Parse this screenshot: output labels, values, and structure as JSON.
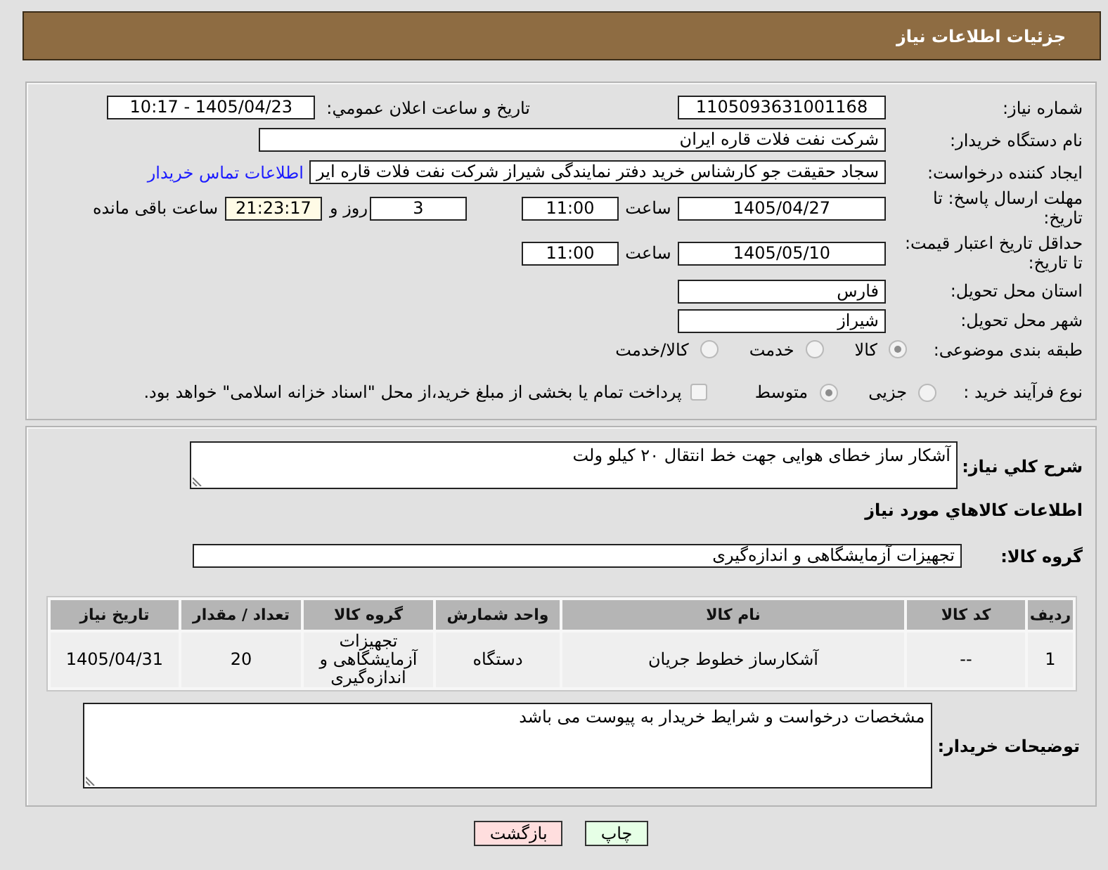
{
  "header": {
    "title": "جزئیات اطلاعات نیاز"
  },
  "details": {
    "need_number": {
      "label": "شماره نیاز:",
      "value": "1105093631001168"
    },
    "announce": {
      "label": "تاریخ و ساعت اعلان عمومي:",
      "value": "1405/04/23 - 10:17"
    },
    "buyer_org": {
      "label": "نام دستگاه خریدار:",
      "value": "شرکت نفت فلات قاره ایران"
    },
    "requester": {
      "label": "ایجاد کننده درخواست:",
      "value": "سجاد حقیقت جو کارشناس خرید دفتر نمایندگی شیراز شرکت نفت فلات قاره ایر",
      "link": "اطلاعات تماس خریدار"
    },
    "reply_deadline": {
      "label": "مهلت ارسال پاسخ: تا تاریخ:",
      "date": "1405/04/27",
      "time_label": "ساعت",
      "time": "11:00",
      "days": "3",
      "days_label": "روز و",
      "remaining": "21:23:17",
      "remaining_label": "ساعت باقی مانده"
    },
    "price_validity": {
      "label": "حداقل تاریخ اعتبار قیمت: تا تاریخ:",
      "date": "1405/05/10",
      "time_label": "ساعت",
      "time": "11:00"
    },
    "province": {
      "label": "استان محل تحویل:",
      "value": "فارس"
    },
    "city": {
      "label": "شهر محل تحویل:",
      "value": "شیراز"
    },
    "category": {
      "label": "طبقه بندی موضوعی:",
      "options": [
        {
          "label": "کالا",
          "selected": true
        },
        {
          "label": "خدمت",
          "selected": false
        },
        {
          "label": "کالا/خدمت",
          "selected": false
        }
      ]
    },
    "process": {
      "label": "نوع فرآیند خرید :",
      "options": [
        {
          "label": "جزیی",
          "selected": false
        },
        {
          "label": "متوسط",
          "selected": true
        }
      ],
      "treasury": {
        "label": "پرداخت تمام یا بخشی از مبلغ خرید،از محل \"اسناد خزانه اسلامی\" خواهد بود.",
        "checked": false
      }
    }
  },
  "need": {
    "summary": {
      "label": "شرح کلي نیاز:",
      "value": "آشکار ساز خطای هوایی جهت خط انتقال ۲۰ کیلو ولت"
    },
    "goods_heading": "اطلاعات کالاهاي مورد نیاز",
    "group": {
      "label": "گروه کالا:",
      "value": "تجهیزات آزمایشگاهی و اندازه‌گیری"
    },
    "table": {
      "columns": [
        "ردیف",
        "کد کالا",
        "نام کالا",
        "واحد شمارش",
        "گروه کالا",
        "تعداد / مقدار",
        "تاریخ نیاز"
      ],
      "rows": [
        [
          "1",
          "--",
          "آشکارساز خطوط جریان",
          "دستگاه",
          "تجهیزات آزمایشگاهی و اندازه‌گیری",
          "20",
          "1405/04/31"
        ]
      ]
    },
    "buyer_notes": {
      "label": "توضیحات خریدار:",
      "value": "مشخصات درخواست و شرایط خریدار به پیوست می باشد"
    }
  },
  "buttons": [
    {
      "label": "چاپ",
      "kind": "print"
    },
    {
      "label": "بازگشت",
      "kind": "back"
    }
  ]
}
